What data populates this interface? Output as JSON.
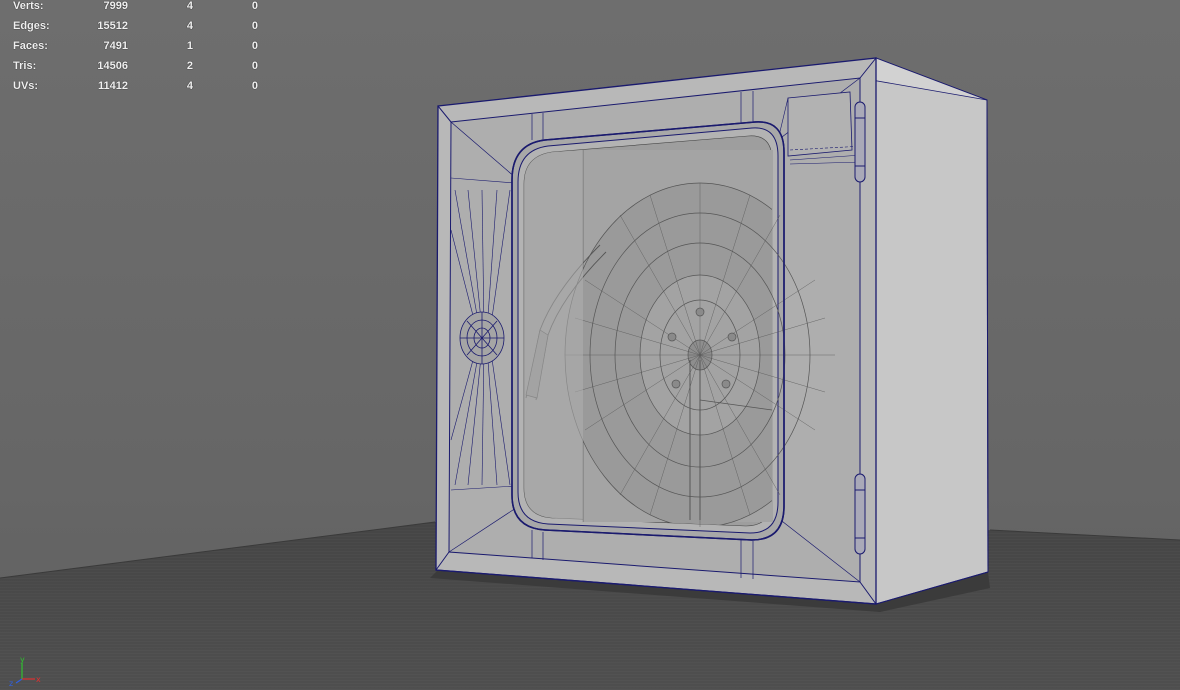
{
  "hud": {
    "rows": [
      {
        "label": "Verts:",
        "v1": "7999",
        "v2": "4",
        "v3": "0"
      },
      {
        "label": "Edges:",
        "v1": "15512",
        "v2": "4",
        "v3": "0"
      },
      {
        "label": "Faces:",
        "v1": "7491",
        "v2": "1",
        "v3": "0"
      },
      {
        "label": "Tris:",
        "v1": "14506",
        "v2": "2",
        "v3": "0"
      },
      {
        "label": "UVs:",
        "v1": "11412",
        "v2": "4",
        "v3": "0"
      }
    ]
  },
  "axis": {
    "x_label": "x",
    "y_label": "y",
    "z_label": "z",
    "x_color": "#e03030",
    "y_color": "#30c030",
    "z_color": "#3060e0"
  },
  "colors": {
    "wireframe": "#1a1a6e",
    "background": "#6b6b6b",
    "floor": "#4a4a4a",
    "cabinet_face": "#b9b9b9",
    "cabinet_side": "#cacaca"
  }
}
